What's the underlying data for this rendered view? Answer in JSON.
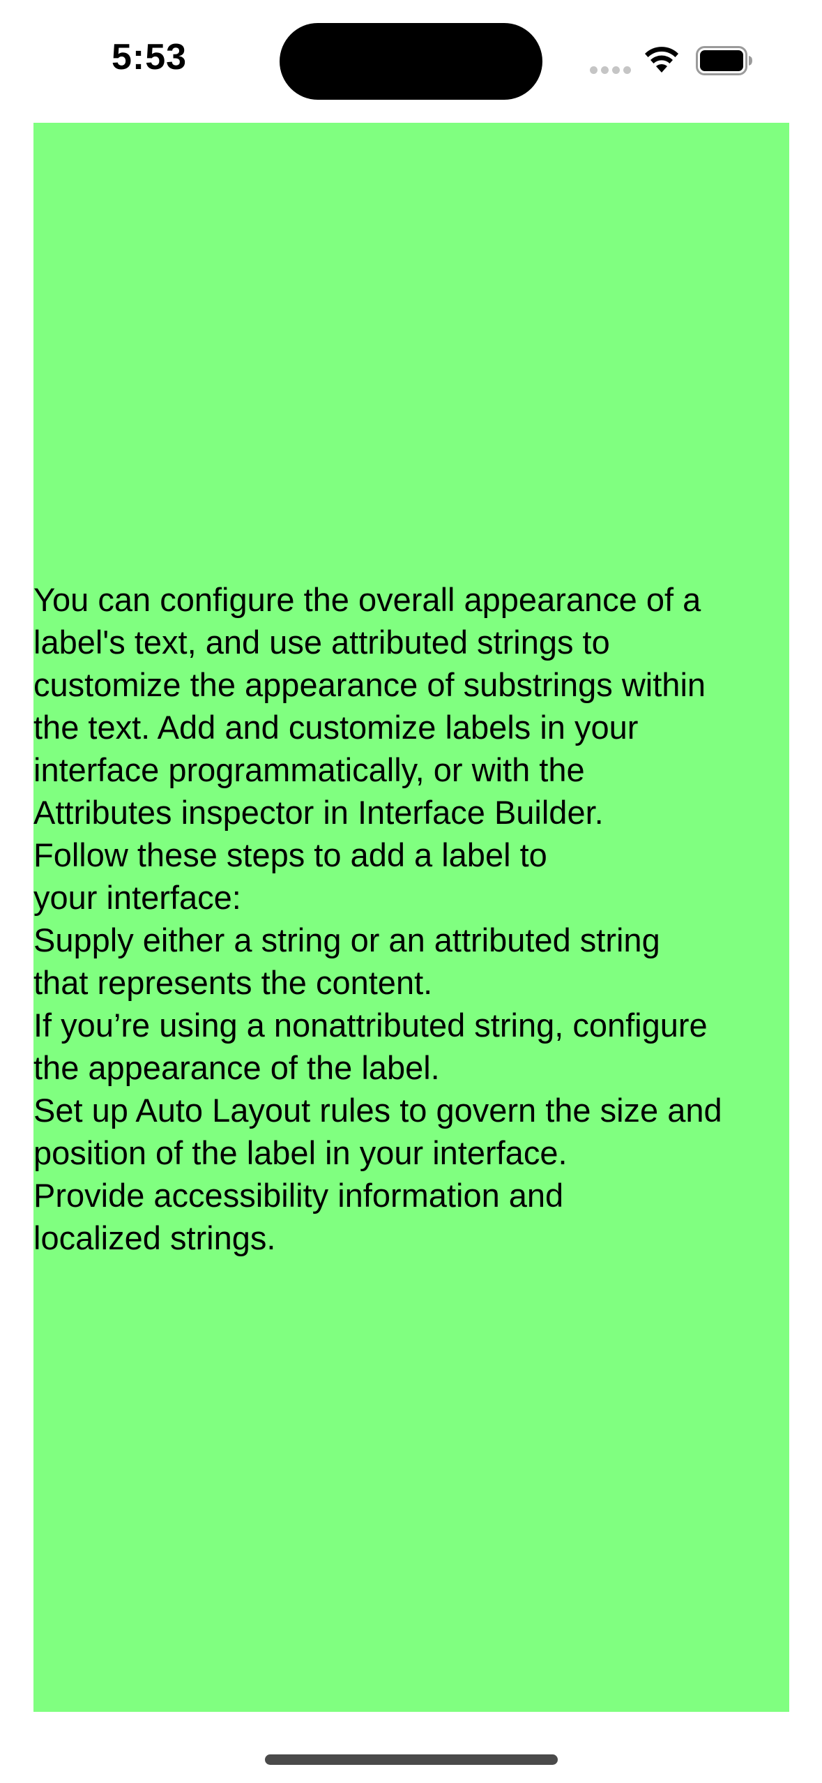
{
  "status_bar": {
    "time": "5:53",
    "icons": [
      "cellular-signal-icon",
      "wifi-icon",
      "battery-icon"
    ]
  },
  "content": {
    "background_color": "#80ff80",
    "label_lines": [
      "You can configure the overall appearance of a",
      "label's text, and use attributed strings to",
      "customize the appearance of substrings within",
      "the text. Add and customize labels in your",
      "interface programmatically, or with the",
      "Attributes inspector in Interface Builder.",
      "Follow these steps to add a label to",
      "your interface:",
      "Supply either a string or an attributed string",
      "that represents the content.",
      "If you’re using a nonattributed string, configure",
      "the appearance of the label.",
      "Set up Auto Layout rules to govern the size and",
      "position of the label in your interface.",
      "Provide accessibility information and",
      "localized strings."
    ]
  }
}
